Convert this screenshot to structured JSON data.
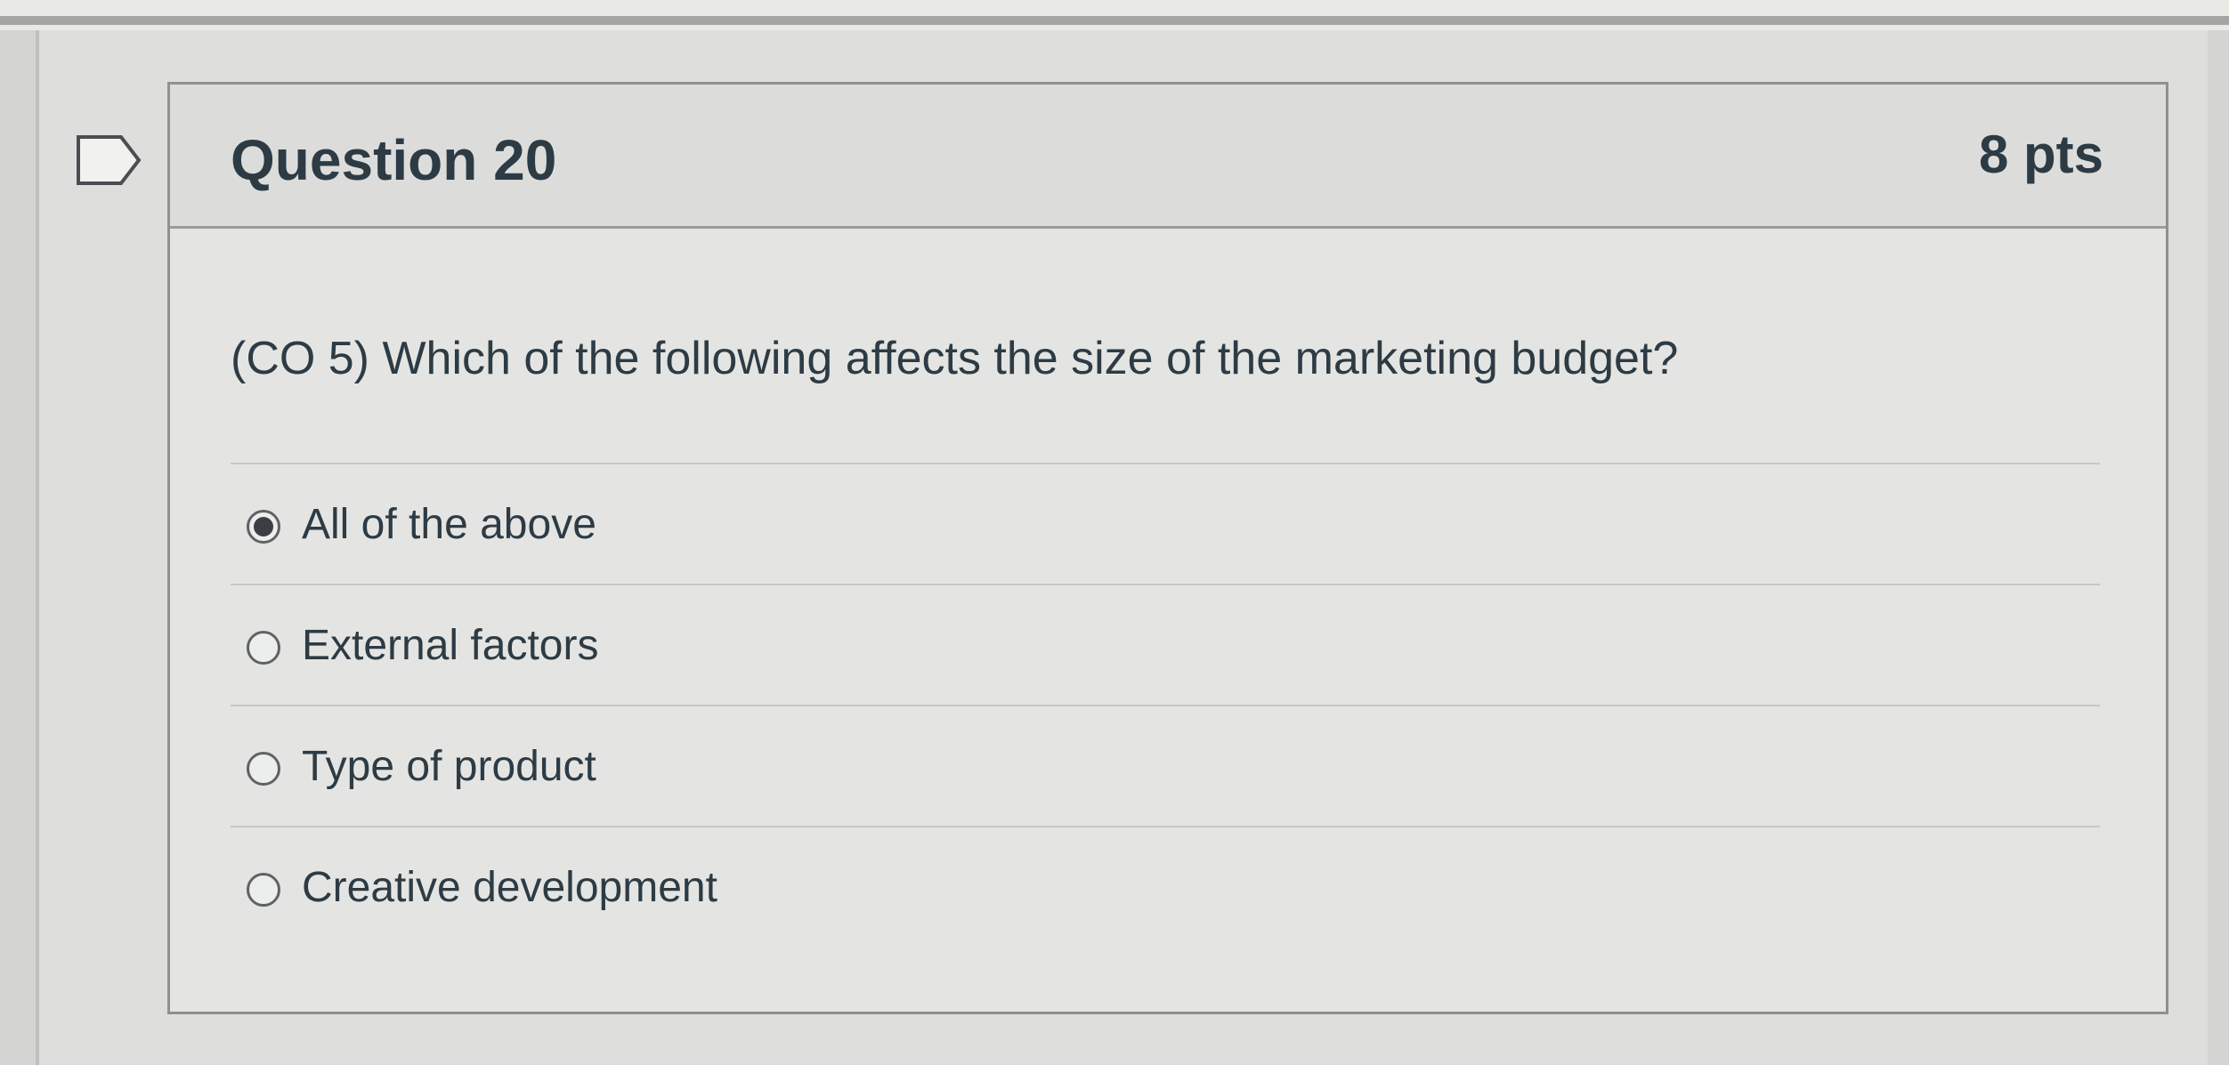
{
  "question": {
    "title": "Question 20",
    "points": "8 pts",
    "text": "(CO 5) Which of the following affects the size of the marketing budget?",
    "answers": [
      {
        "label": "All of the above",
        "selected": true
      },
      {
        "label": "External factors",
        "selected": false
      },
      {
        "label": "Type of product",
        "selected": false
      },
      {
        "label": "Creative development",
        "selected": false
      }
    ]
  },
  "icons": {
    "bookmark": "bookmark-flag-icon"
  }
}
